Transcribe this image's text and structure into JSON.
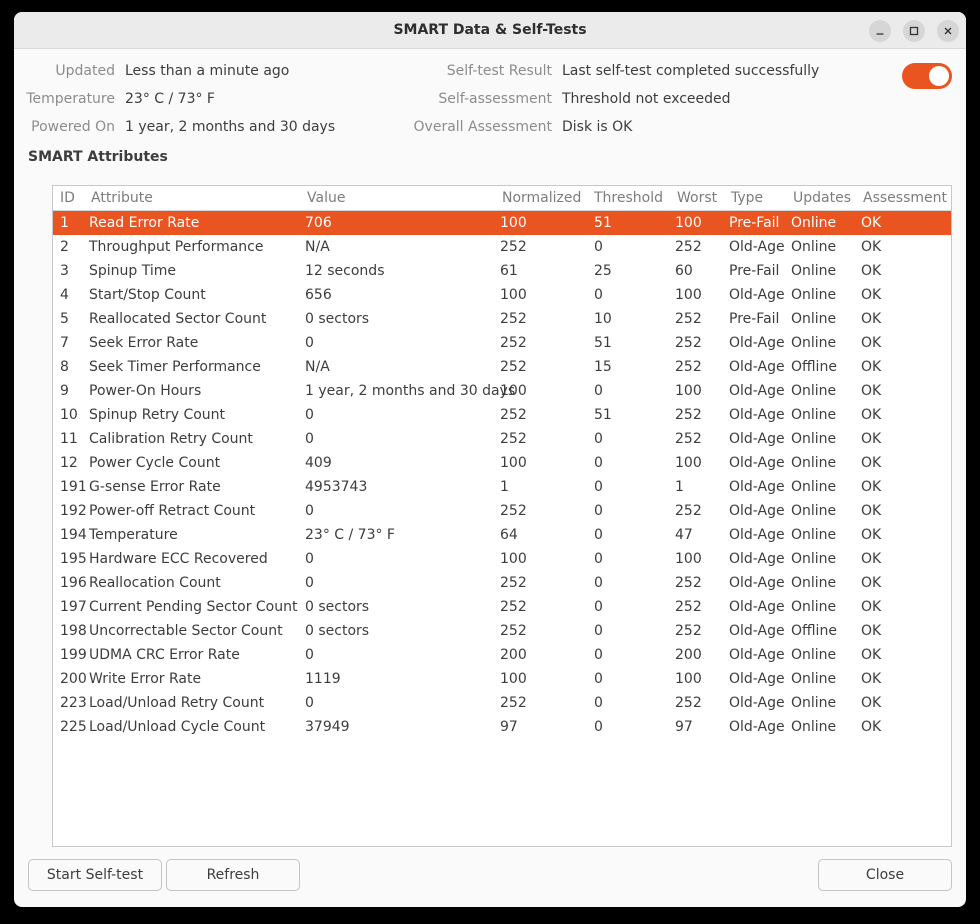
{
  "window": {
    "title": "SMART Data & Self-Tests",
    "accent_color": "#e95420"
  },
  "info": {
    "updated_label": "Updated",
    "updated_value": "Less than a minute ago",
    "temperature_label": "Temperature",
    "temperature_value": "23° C / 73° F",
    "powered_on_label": "Powered On",
    "powered_on_value": "1 year, 2 months and 30 days",
    "self_test_result_label": "Self-test Result",
    "self_test_result_value": "Last self-test completed successfully",
    "self_assessment_label": "Self-assessment",
    "self_assessment_value": "Threshold not exceeded",
    "overall_assessment_label": "Overall Assessment",
    "overall_assessment_value": "Disk is OK",
    "smart_enabled": true
  },
  "section": {
    "title": "SMART Attributes"
  },
  "table": {
    "headers": [
      "ID",
      "Attribute",
      "Value",
      "Normalized",
      "Threshold",
      "Worst",
      "Type",
      "Updates",
      "Assessment"
    ],
    "selected_row": 0,
    "rows": [
      [
        "1",
        "Read Error Rate",
        "706",
        "100",
        "51",
        "100",
        "Pre-Fail",
        "Online",
        "OK"
      ],
      [
        "2",
        "Throughput Performance",
        "N/A",
        "252",
        "0",
        "252",
        "Old-Age",
        "Online",
        "OK"
      ],
      [
        "3",
        "Spinup Time",
        "12 seconds",
        "61",
        "25",
        "60",
        "Pre-Fail",
        "Online",
        "OK"
      ],
      [
        "4",
        "Start/Stop Count",
        "656",
        "100",
        "0",
        "100",
        "Old-Age",
        "Online",
        "OK"
      ],
      [
        "5",
        "Reallocated Sector Count",
        "0 sectors",
        "252",
        "10",
        "252",
        "Pre-Fail",
        "Online",
        "OK"
      ],
      [
        "7",
        "Seek Error Rate",
        "0",
        "252",
        "51",
        "252",
        "Old-Age",
        "Online",
        "OK"
      ],
      [
        "8",
        "Seek Timer Performance",
        "N/A",
        "252",
        "15",
        "252",
        "Old-Age",
        "Offline",
        "OK"
      ],
      [
        "9",
        "Power-On Hours",
        "1 year, 2 months and 30 days",
        "100",
        "0",
        "100",
        "Old-Age",
        "Online",
        "OK"
      ],
      [
        "10",
        "Spinup Retry Count",
        "0",
        "252",
        "51",
        "252",
        "Old-Age",
        "Online",
        "OK"
      ],
      [
        "11",
        "Calibration Retry Count",
        "0",
        "252",
        "0",
        "252",
        "Old-Age",
        "Online",
        "OK"
      ],
      [
        "12",
        "Power Cycle Count",
        "409",
        "100",
        "0",
        "100",
        "Old-Age",
        "Online",
        "OK"
      ],
      [
        "191",
        "G-sense Error Rate",
        "4953743",
        "1",
        "0",
        "1",
        "Old-Age",
        "Online",
        "OK"
      ],
      [
        "192",
        "Power-off Retract Count",
        "0",
        "252",
        "0",
        "252",
        "Old-Age",
        "Online",
        "OK"
      ],
      [
        "194",
        "Temperature",
        "23° C / 73° F",
        "64",
        "0",
        "47",
        "Old-Age",
        "Online",
        "OK"
      ],
      [
        "195",
        "Hardware ECC Recovered",
        "0",
        "100",
        "0",
        "100",
        "Old-Age",
        "Online",
        "OK"
      ],
      [
        "196",
        "Reallocation Count",
        "0",
        "252",
        "0",
        "252",
        "Old-Age",
        "Online",
        "OK"
      ],
      [
        "197",
        "Current Pending Sector Count",
        "0 sectors",
        "252",
        "0",
        "252",
        "Old-Age",
        "Online",
        "OK"
      ],
      [
        "198",
        "Uncorrectable Sector Count",
        "0 sectors",
        "252",
        "0",
        "252",
        "Old-Age",
        "Offline",
        "OK"
      ],
      [
        "199",
        "UDMA CRC Error Rate",
        "0",
        "200",
        "0",
        "200",
        "Old-Age",
        "Online",
        "OK"
      ],
      [
        "200",
        "Write Error Rate",
        "1119",
        "100",
        "0",
        "100",
        "Old-Age",
        "Online",
        "OK"
      ],
      [
        "223",
        "Load/Unload Retry Count",
        "0",
        "252",
        "0",
        "252",
        "Old-Age",
        "Online",
        "OK"
      ],
      [
        "225",
        "Load/Unload Cycle Count",
        "37949",
        "97",
        "0",
        "97",
        "Old-Age",
        "Online",
        "OK"
      ]
    ]
  },
  "buttons": {
    "start_self_test": "Start Self-test",
    "refresh": "Refresh",
    "close": "Close"
  },
  "icons": {
    "minimize": "minimize-icon",
    "maximize": "maximize-icon",
    "close": "close-icon"
  }
}
